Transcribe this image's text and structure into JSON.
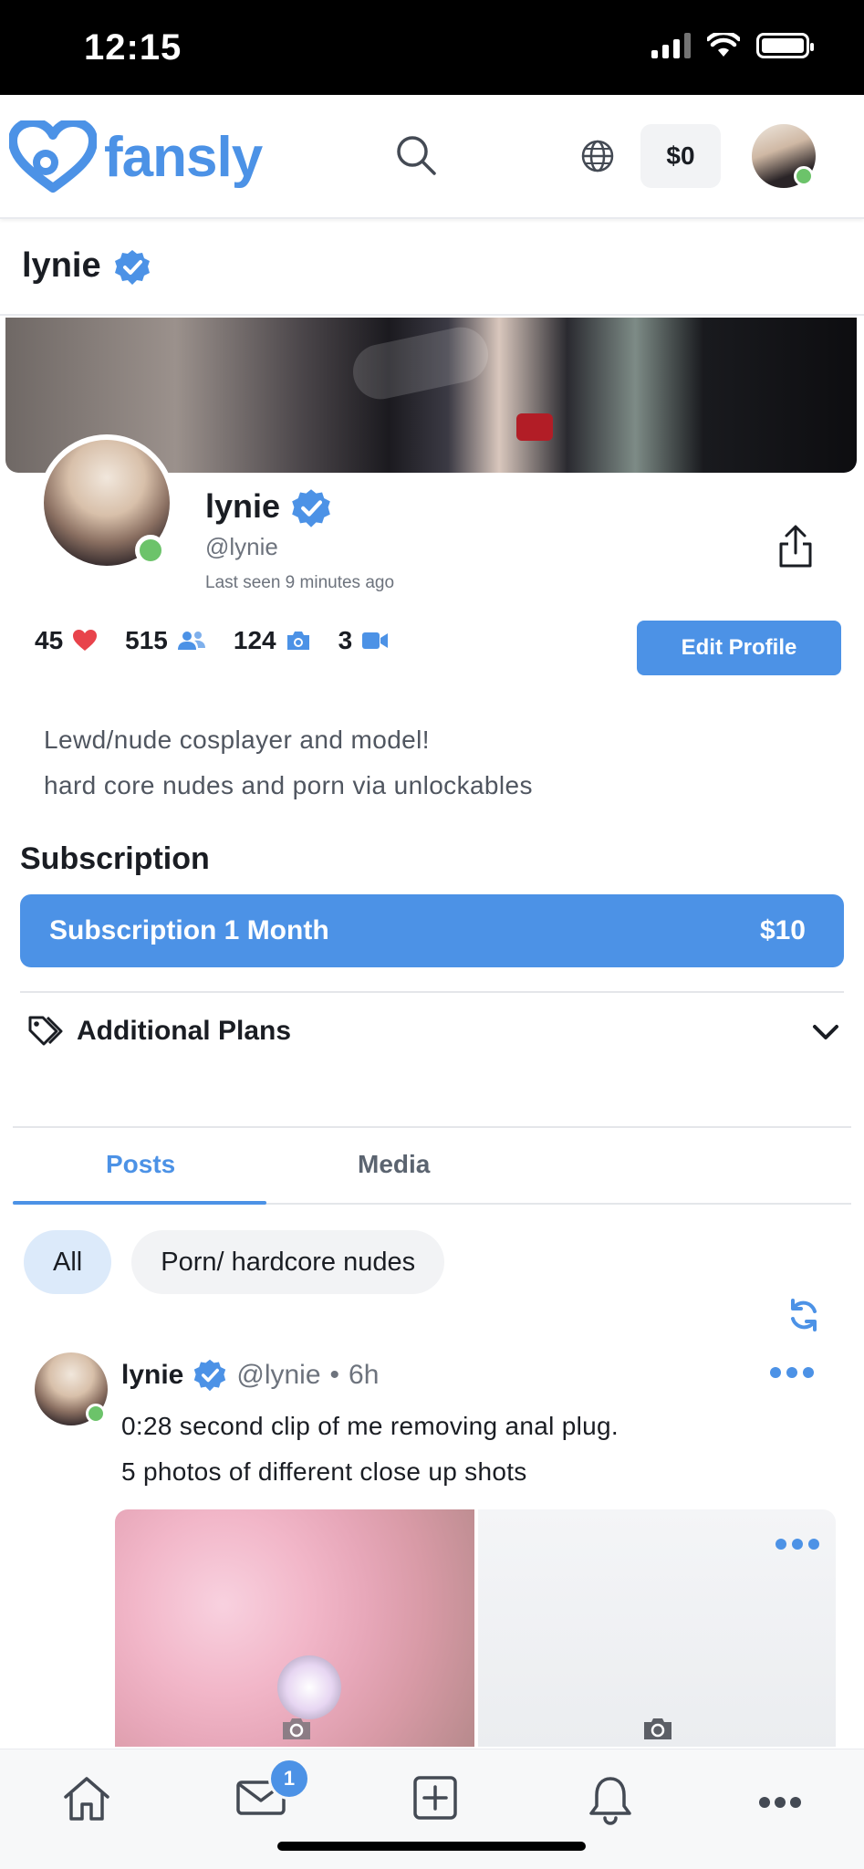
{
  "status_bar": {
    "time": "12:15"
  },
  "header": {
    "brand": "fansly",
    "wallet_balance": "$0"
  },
  "name_row": {
    "name": "lynie"
  },
  "profile": {
    "display_name": "lynie",
    "handle": "@lynie",
    "last_seen": "Last seen 9 minutes ago",
    "edit_label": "Edit Profile",
    "stats": {
      "likes": "45",
      "followers": "515",
      "photos": "124",
      "videos": "3"
    },
    "bio_line1": "Lewd/nude cosplayer and model!",
    "bio_line2": "hard core nudes and porn via unlockables"
  },
  "subscription": {
    "heading": "Subscription",
    "plan_label": "Subscription 1 Month",
    "plan_price": "$10",
    "additional_plans": "Additional Plans"
  },
  "tabs": {
    "posts": "Posts",
    "media": "Media"
  },
  "filters": {
    "all": "All",
    "tag": "Porn/ hardcore nudes"
  },
  "post": {
    "name": "lynie",
    "handle": "@lynie",
    "sep": "•",
    "age": "6h",
    "line1": "0:28 second clip of me removing anal plug.",
    "line2": "5 photos of different close up shots"
  },
  "nav": {
    "mail_badge": "1"
  },
  "colors": {
    "accent": "#4c92e6",
    "online": "#6cc36a",
    "heart": "#e8434b"
  }
}
